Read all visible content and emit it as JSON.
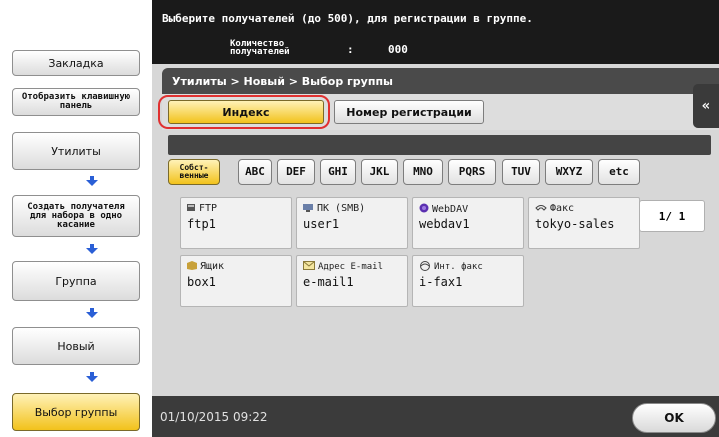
{
  "header": {
    "message": "Выберите получателей (до 500), для регистрации в группе.",
    "count_label": "Количество получателей",
    "count_colon": ":",
    "count_value": "000"
  },
  "sidebar": {
    "bookmark": "Закладка",
    "show_keypad": "Отобразить клавишную панель",
    "steps": [
      {
        "label": "Утилиты"
      },
      {
        "label": "Создать получателя для набора в одно касание"
      },
      {
        "label": "Группа"
      },
      {
        "label": "Новый"
      },
      {
        "label": "Выбор группы"
      }
    ]
  },
  "breadcrumb": "Утилиты > Новый > Выбор группы",
  "tabs": [
    {
      "label": "Индекс",
      "active": true
    },
    {
      "label": "Номер регистрации",
      "active": false
    }
  ],
  "index_keys": [
    "Собст- венные",
    "ABC",
    "DEF",
    "GHI",
    "JKL",
    "MNO",
    "PQRS",
    "TUV",
    "WXYZ",
    "etc"
  ],
  "entries": [
    {
      "type": "FTP",
      "name": "ftp1",
      "icon": "ftp-icon"
    },
    {
      "type": "ПК (SMB)",
      "name": "user1",
      "icon": "pc-smb-icon"
    },
    {
      "type": "WebDAV",
      "name": "webdav1",
      "icon": "webdav-icon"
    },
    {
      "type": "Факс",
      "name": "tokyo-sales",
      "icon": "fax-icon"
    },
    {
      "type": "Ящик",
      "name": "box1",
      "icon": "box-icon"
    },
    {
      "type": "Адрес E-mail",
      "name": "e-mail1",
      "icon": "email-icon"
    },
    {
      "type": "Инт. факс",
      "name": "i-fax1",
      "icon": "ifax-icon"
    }
  ],
  "page_indicator": "1/ 1",
  "footer": {
    "datetime": "01/10/2015  09:22",
    "ok_label": "OK"
  },
  "colors": {
    "accent_yellow": "#f2c21b",
    "header_bg": "#1a1a1a",
    "panel_bg": "#d7d7d7",
    "highlight_red": "#e03030"
  }
}
